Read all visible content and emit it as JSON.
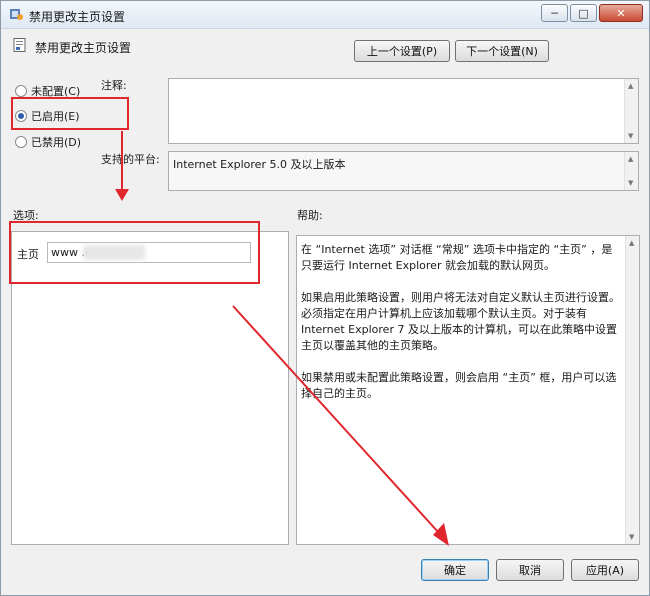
{
  "window": {
    "title": "禁用更改主页设置",
    "controls": {
      "minimize": "─",
      "maximize": "□",
      "close": "✕"
    }
  },
  "policy": {
    "title": "禁用更改主页设置"
  },
  "nav": {
    "prev_label": "上一个设置(P)",
    "next_label": "下一个设置(N)"
  },
  "state": {
    "options": [
      {
        "label": "未配置(C)",
        "selected": false
      },
      {
        "label": "已启用(E)",
        "selected": true
      },
      {
        "label": "已禁用(D)",
        "selected": false
      }
    ]
  },
  "comment": {
    "label": "注释:",
    "value": ""
  },
  "platform": {
    "label": "支持的平台:",
    "value": "Internet Explorer 5.0 及以上版本"
  },
  "options_panel": {
    "label": "选项:",
    "home_label": "主页",
    "home_value": "www                    .com"
  },
  "help_panel": {
    "label": "帮助:",
    "paragraphs": [
      "在 “Internet 选项” 对话框 “常规” 选项卡中指定的 “主页” ，是只要运行 Internet Explorer 就会加载的默认网页。",
      "如果启用此策略设置，则用户将无法对自定义默认主页进行设置。必须指定在用户计算机上应该加载哪个默认主页。对于装有 Internet Explorer 7 及以上版本的计算机，可以在此策略中设置主页以覆盖其他的主页策略。",
      "如果禁用或未配置此策略设置，则会启用 “主页” 框，用户可以选择自己的主页。"
    ]
  },
  "footer": {
    "ok_label": "确定",
    "cancel_label": "取消",
    "apply_label": "应用(A)"
  },
  "colors": {
    "annotation": "#e0272d",
    "titlebar": "#dfe8f3"
  }
}
